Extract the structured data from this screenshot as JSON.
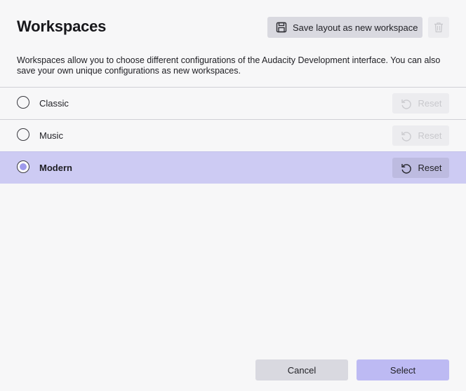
{
  "dialog": {
    "title": "Workspaces",
    "save_layout_label": "Save layout as new workspace",
    "description": "Workspaces allow you to choose different configurations of the Audacity Development interface. You can also save your own unique configurations as new workspaces."
  },
  "workspaces": [
    {
      "name": "Classic",
      "selected": false,
      "reset_label": "Reset",
      "reset_enabled": false
    },
    {
      "name": "Music",
      "selected": false,
      "reset_label": "Reset",
      "reset_enabled": false
    },
    {
      "name": "Modern",
      "selected": true,
      "reset_label": "Reset",
      "reset_enabled": true
    }
  ],
  "footer": {
    "cancel_label": "Cancel",
    "select_label": "Select"
  },
  "icons": {
    "save": "floppy-disk-icon",
    "delete": "trash-icon",
    "reset": "undo-arrow-icon"
  },
  "colors": {
    "selected_row": "#cdcbf3",
    "radio_dot": "#9e9aec",
    "select_button": "#bdbaf3"
  }
}
